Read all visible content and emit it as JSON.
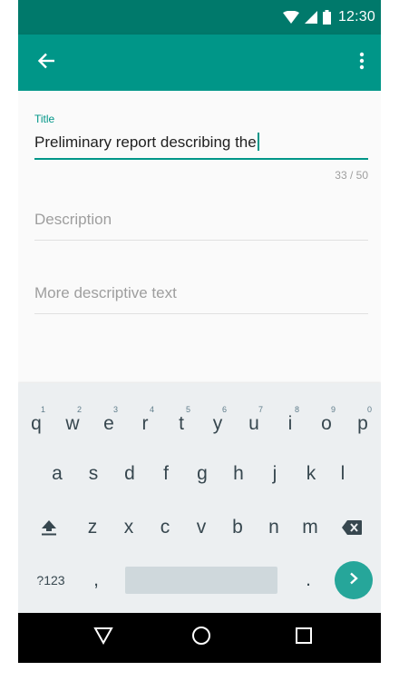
{
  "colors": {
    "status_bar": "#00796b",
    "app_bar": "#009688",
    "accent": "#009688",
    "keyboard_bg": "#eceff1",
    "enter_key": "#26a69a",
    "nav_bar": "#000000"
  },
  "status_bar": {
    "time": "12:30",
    "icons": [
      "wifi-icon",
      "signal-icon",
      "battery-icon"
    ]
  },
  "app_bar": {
    "left_icon": "back-arrow-icon",
    "right_icon": "more-vert-icon"
  },
  "form": {
    "title_label": "Title",
    "title_value": "Preliminary report describing the",
    "counter": "33 / 50",
    "description_placeholder": "Description",
    "more_placeholder": "More descriptive text"
  },
  "keyboard": {
    "row1": [
      {
        "key": "q",
        "hint": "1"
      },
      {
        "key": "w",
        "hint": "2"
      },
      {
        "key": "e",
        "hint": "3"
      },
      {
        "key": "r",
        "hint": "4"
      },
      {
        "key": "t",
        "hint": "5"
      },
      {
        "key": "y",
        "hint": "6"
      },
      {
        "key": "u",
        "hint": "7"
      },
      {
        "key": "i",
        "hint": "8"
      },
      {
        "key": "o",
        "hint": "9"
      },
      {
        "key": "p",
        "hint": "0"
      }
    ],
    "row2": [
      "a",
      "s",
      "d",
      "f",
      "g",
      "h",
      "j",
      "k",
      "l"
    ],
    "row3": [
      "z",
      "x",
      "c",
      "v",
      "b",
      "n",
      "m"
    ],
    "symbols_label": "?123",
    "comma": ",",
    "period": ".",
    "shift_icon": "shift-icon",
    "backspace_icon": "backspace-icon",
    "enter_icon": "chevron-right-icon"
  },
  "nav_bar": {
    "icons": [
      "back-triangle-icon",
      "home-circle-icon",
      "recents-square-icon"
    ]
  }
}
